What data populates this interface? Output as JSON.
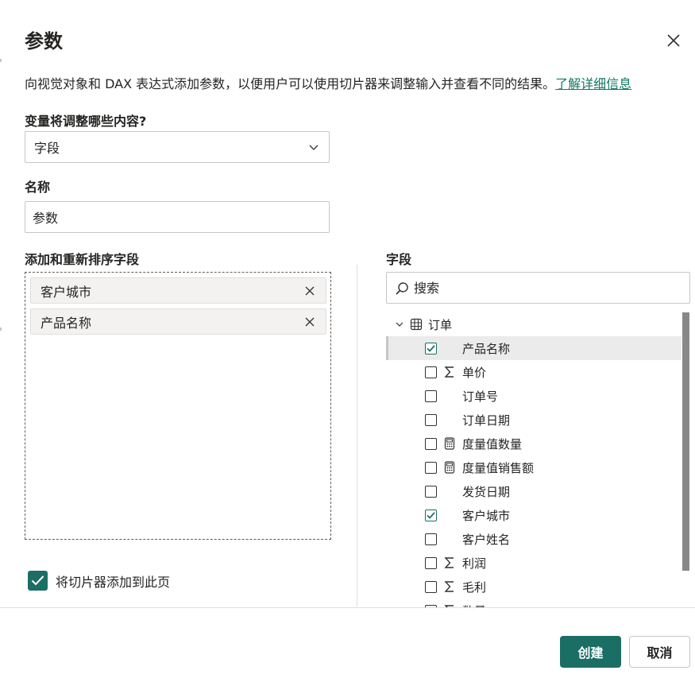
{
  "dialog": {
    "title": "参数",
    "description": "向视觉对象和 DAX 表达式添加参数，以便用户可以使用切片器来调整输入并查看不同的结果。",
    "learn_more": "了解详细信息"
  },
  "variable": {
    "label": "变量将调整哪些内容?",
    "selected": "字段"
  },
  "name": {
    "label": "名称",
    "value": "参数"
  },
  "order": {
    "label": "添加和重新排序字段",
    "chips": [
      "客户城市",
      "产品名称"
    ]
  },
  "fields": {
    "label": "字段",
    "search_placeholder": "搜索",
    "table_name": "订单",
    "items": [
      {
        "label": "产品名称",
        "checked": true,
        "icon": "none"
      },
      {
        "label": "单价",
        "checked": false,
        "icon": "sigma-icon"
      },
      {
        "label": "订单号",
        "checked": false,
        "icon": "none"
      },
      {
        "label": "订单日期",
        "checked": false,
        "icon": "none"
      },
      {
        "label": "度量值数量",
        "checked": false,
        "icon": "calculator-icon"
      },
      {
        "label": "度量值销售额",
        "checked": false,
        "icon": "calculator-icon"
      },
      {
        "label": "发货日期",
        "checked": false,
        "icon": "none"
      },
      {
        "label": "客户城市",
        "checked": true,
        "icon": "none"
      },
      {
        "label": "客户姓名",
        "checked": false,
        "icon": "none"
      },
      {
        "label": "利润",
        "checked": false,
        "icon": "sigma-icon"
      },
      {
        "label": "毛利",
        "checked": false,
        "icon": "sigma-icon"
      },
      {
        "label": "数量",
        "checked": false,
        "icon": "sigma-icon"
      }
    ]
  },
  "slicer": {
    "label": "将切片器添加到此页",
    "checked": true
  },
  "buttons": {
    "create": "创建",
    "cancel": "取消"
  },
  "colors": {
    "accent": "#1b6e63",
    "link": "#117865"
  }
}
